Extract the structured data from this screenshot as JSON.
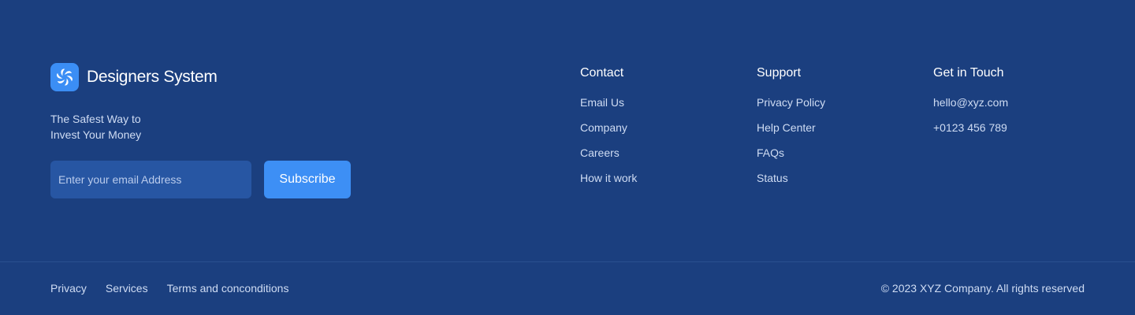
{
  "brand": {
    "name": "Designers System",
    "logo_icon": "aperture-swirl-icon",
    "logo_color": "#3b8ef5"
  },
  "tagline": {
    "line1": "The Safest Way to",
    "line2": "Invest Your Money"
  },
  "newsletter": {
    "placeholder": "Enter your email Address",
    "value": "",
    "button_label": "Subscribe"
  },
  "columns": {
    "contact": {
      "title": "Contact",
      "items": [
        "Email Us",
        "Company",
        "Careers",
        "How it work"
      ]
    },
    "support": {
      "title": "Support",
      "items": [
        "Privacy Policy",
        "Help Center",
        "FAQs",
        "Status"
      ]
    },
    "get_in_touch": {
      "title": "Get in Touch",
      "items": [
        "hello@xyz.com",
        "+0123 456 789"
      ]
    }
  },
  "bottom_bar": {
    "links": [
      "Privacy",
      "Services",
      "Terms and conconditions"
    ],
    "copyright": "© 2023 XYZ Company. All rights reserved"
  },
  "colors": {
    "background": "#1b3f7f",
    "accent": "#3d8ff5",
    "input_bg": "#2756a3",
    "muted_text": "#cfdcf3"
  }
}
